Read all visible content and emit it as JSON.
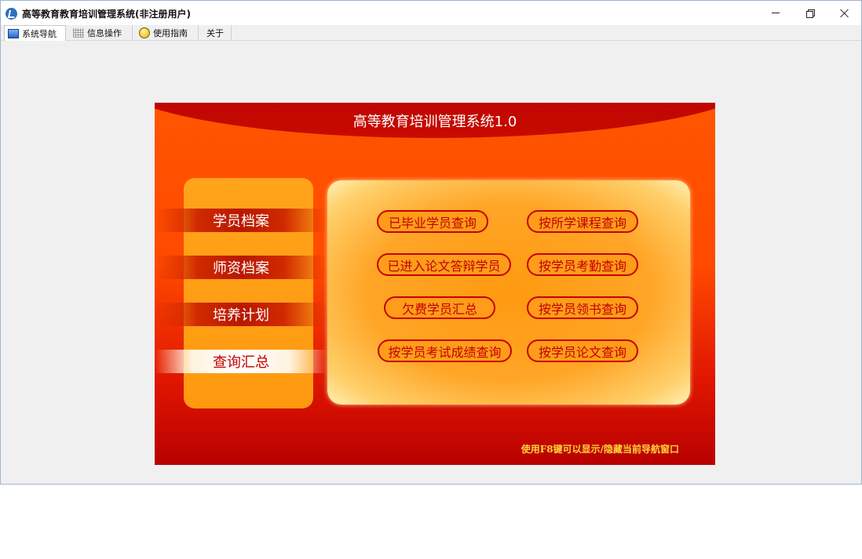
{
  "window": {
    "title": "高等教育教育培训管理系统(非注册用户)"
  },
  "tabs": [
    {
      "label": "系统导航",
      "icon": "monitor-icon",
      "active": true
    },
    {
      "label": "信息操作",
      "icon": "grid-icon",
      "active": false
    },
    {
      "label": "使用指南",
      "icon": "guide-icon",
      "active": false
    },
    {
      "label": "关于",
      "icon": "",
      "active": false
    }
  ],
  "panel": {
    "title": "高等教育培训管理系统1.0",
    "nav": [
      {
        "label": "学员档案",
        "selected": false
      },
      {
        "label": "师资档案",
        "selected": false
      },
      {
        "label": "培养计划",
        "selected": false
      },
      {
        "label": "查询汇总",
        "selected": true
      }
    ],
    "queries": [
      "已毕业学员查询",
      "按所学课程查询",
      "已进入论文答辩学员",
      "按学员考勤查询",
      "欠费学员汇总",
      "按学员领书查询",
      "按学员考试成绩查询",
      "按学员论文查询"
    ],
    "hint": "使用F8键可以显示/隐藏当前导航窗口"
  },
  "colors": {
    "panel_primary": "#ff4a00",
    "panel_dark": "#b80000",
    "query_border": "#c80000",
    "hint_text": "#ffd23a"
  }
}
